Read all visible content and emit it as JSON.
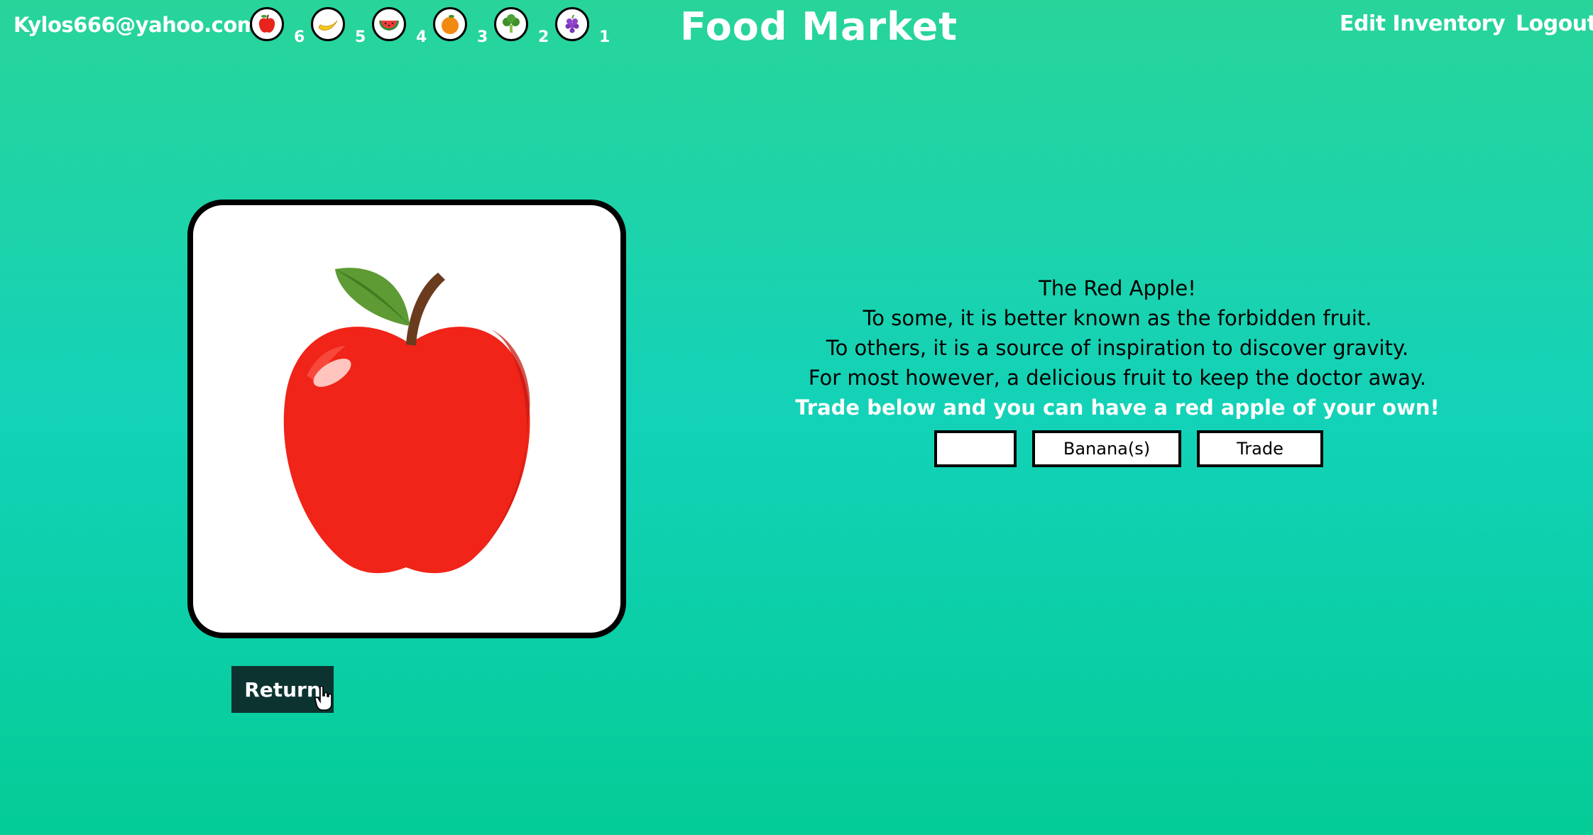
{
  "header": {
    "user_email": "Kylos666@yahoo.com",
    "title": "Food Market",
    "nav": {
      "edit_inventory": "Edit Inventory",
      "logout": "Logout"
    },
    "inventory": [
      {
        "icon": "apple-icon",
        "count": "6"
      },
      {
        "icon": "banana-icon",
        "count": "5"
      },
      {
        "icon": "watermelon-icon",
        "count": "4"
      },
      {
        "icon": "orange-icon",
        "count": "3"
      },
      {
        "icon": "broccoli-icon",
        "count": "2"
      },
      {
        "icon": "grapes-icon",
        "count": "1"
      }
    ]
  },
  "product": {
    "image": "red-apple-icon",
    "lines": [
      "The Red Apple!",
      "To some, it is better known as the forbidden fruit.",
      "To others, it is a source of inspiration to discover gravity.",
      "For most however, a delicious fruit to keep the doctor away."
    ],
    "cta": "Trade below and you can have a red apple of your own!"
  },
  "trade": {
    "quantity_value": "",
    "selected_fruit": "Banana(s)",
    "trade_label": "Trade"
  },
  "return_label": "Return",
  "colors": {
    "background_top": "#28d49a",
    "background_mid": "#13d2b8",
    "return_button": "#0d3330",
    "apple_red": "#f02418"
  }
}
